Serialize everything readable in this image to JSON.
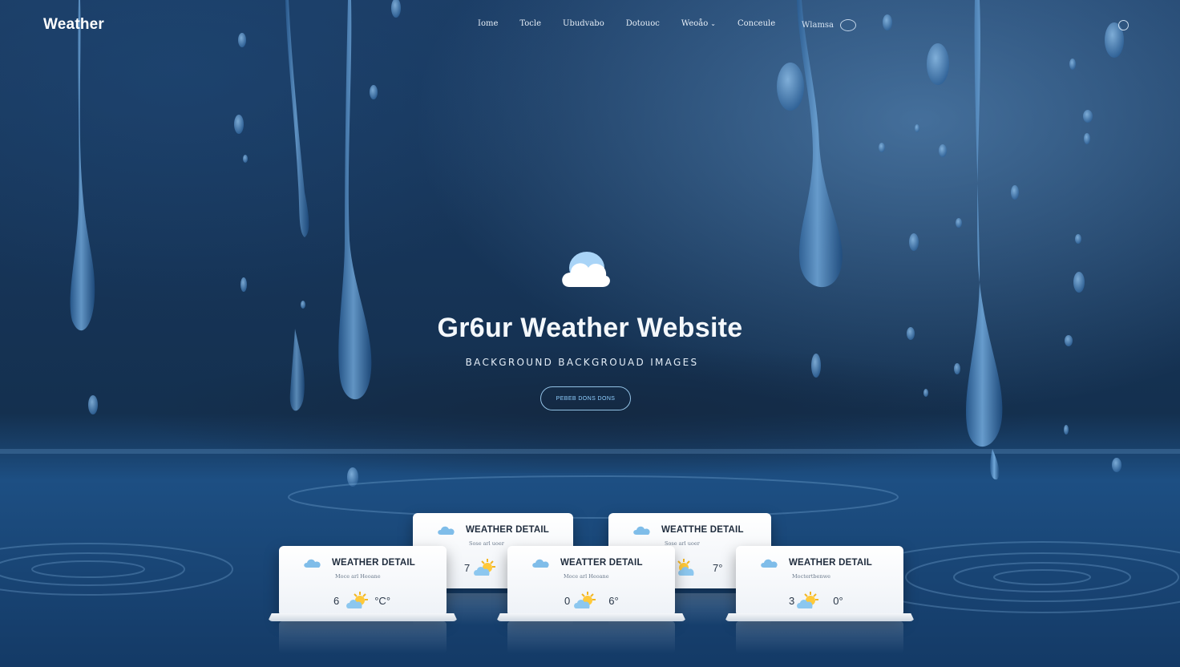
{
  "header": {
    "logo": "Weather",
    "nav": [
      {
        "label": "Iome"
      },
      {
        "label": "Tocle"
      },
      {
        "label": "Ubudvabo"
      },
      {
        "label": "Dotouoc"
      },
      {
        "label": "Weoåo",
        "dropdown": true
      },
      {
        "label": "Conceule"
      }
    ],
    "search_text": "Wlamsa"
  },
  "hero": {
    "title": "Gr6ur Weather Website",
    "subtitle": "BACKGROUND BACKGROUAD IMAGES",
    "cta_label": "PEBEB DONS DONS"
  },
  "cards": [
    {
      "title": "WEATHER DETAIL",
      "sub": "Sose arl uoer",
      "t1": "7",
      "t2": ""
    },
    {
      "title": "WEATTHE DETAIL",
      "sub": "Sose arl uoer",
      "t1": "",
      "t2": "7°"
    },
    {
      "title": "WEATHER DETAIL",
      "sub": "Moce arl Heoane",
      "t1": "6",
      "t2": "°C°"
    },
    {
      "title": "WEATTER DETAIL",
      "sub": "Moce arl Heoane",
      "t1": "0",
      "t2": "6°"
    },
    {
      "title": "WEATHER DETAIL",
      "sub": "Moctertbenwe",
      "t1": "3",
      "t2": "0°"
    }
  ],
  "colors": {
    "accent": "#8fd0ff",
    "bg_deep": "#13345a",
    "card": "#ffffff"
  },
  "icons": {
    "cloud": "cloud-icon",
    "sun_cloud": "sun-cloud-icon",
    "search": "search-icon"
  }
}
